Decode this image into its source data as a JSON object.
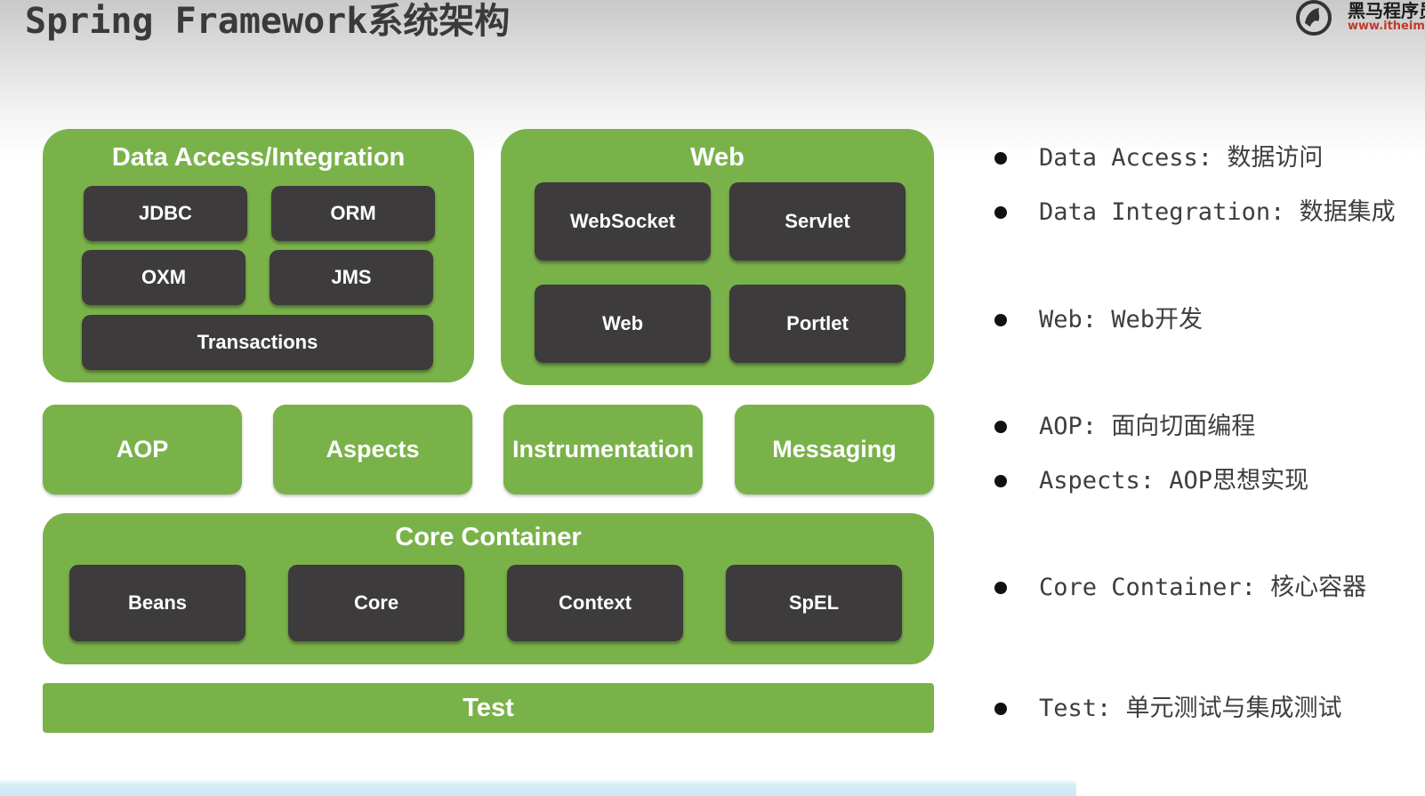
{
  "title": "Spring Framework系统架构",
  "logo": {
    "name": "黑马程序员",
    "url": "www.itheima.com",
    "icon": "horse-logo-icon"
  },
  "diagram": {
    "data_access": {
      "title": "Data Access/Integration",
      "modules": [
        "JDBC",
        "ORM",
        "OXM",
        "JMS",
        "Transactions"
      ]
    },
    "web": {
      "title": "Web",
      "modules": [
        "WebSocket",
        "Servlet",
        "Web",
        "Portlet"
      ]
    },
    "middle": [
      "AOP",
      "Aspects",
      "Instrumentation",
      "Messaging"
    ],
    "core_container": {
      "title": "Core Container",
      "modules": [
        "Beans",
        "Core",
        "Context",
        "SpEL"
      ]
    },
    "test": "Test"
  },
  "colors": {
    "green": "#7ab24a",
    "dark": "#3d3b3b"
  },
  "notes": [
    "Data Access: 数据访问",
    "Data Integration: 数据集成",
    "Web: Web开发",
    "AOP: 面向切面编程",
    "Aspects: AOP思想实现",
    "Core Container: 核心容器",
    "Test: 单元测试与集成测试"
  ]
}
